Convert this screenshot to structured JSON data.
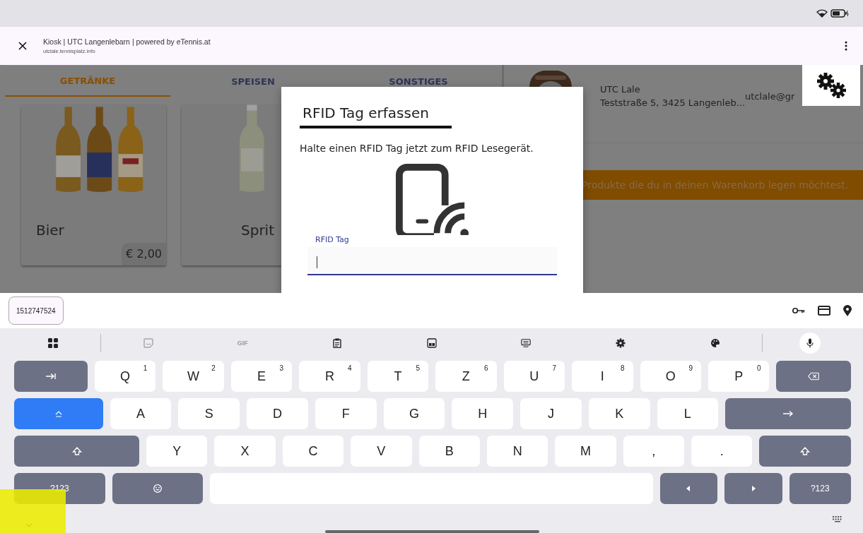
{
  "browser": {
    "title": "Kiosk | UTC Langenlebarn | powered by eTennis.at",
    "url": "utclale.tennisplatz.info"
  },
  "tabs": [
    {
      "label": "GETRÄNKE",
      "selected": true
    },
    {
      "label": "SPEISEN",
      "selected": false
    },
    {
      "label": "SONSTIGES",
      "selected": false
    }
  ],
  "products": [
    {
      "name": "Bier",
      "price": "€ 2,00"
    },
    {
      "name": "Sprit"
    }
  ],
  "club": {
    "name": "UTC Lale",
    "address": "Teststraße 5, 3425 Langenleb...",
    "email": "utclale@gr"
  },
  "banner": "Produkte die du in deinen Warenkorb legen möchtest.",
  "dialog": {
    "title": "RFID Tag erfassen",
    "text": "Halte einen RFID Tag jetzt zum RFID Lesegerät.",
    "field_label": "RFID Tag"
  },
  "suggestion": "1512747524",
  "toolbar": [
    {
      "kind": "apps",
      "disabled": false
    },
    {
      "kind": "sticker",
      "disabled": true
    },
    {
      "kind": "gif",
      "label": "GIF",
      "disabled": true
    },
    {
      "kind": "clipboard",
      "disabled": false
    },
    {
      "kind": "translate",
      "disabled": false
    },
    {
      "kind": "screen",
      "disabled": false
    },
    {
      "kind": "settings",
      "disabled": false
    },
    {
      "kind": "palette",
      "disabled": false
    },
    {
      "kind": "mic",
      "disabled": false
    }
  ],
  "rows": [
    [
      {
        "kind": "tab"
      },
      {
        "kind": "letter",
        "label": "Q",
        "hint": "1"
      },
      {
        "kind": "letter",
        "label": "W",
        "hint": "2"
      },
      {
        "kind": "letter",
        "label": "E",
        "hint": "3"
      },
      {
        "kind": "letter",
        "label": "R",
        "hint": "4"
      },
      {
        "kind": "letter",
        "label": "T",
        "hint": "5"
      },
      {
        "kind": "letter",
        "label": "Z",
        "hint": "6"
      },
      {
        "kind": "letter",
        "label": "U",
        "hint": "7"
      },
      {
        "kind": "letter",
        "label": "I",
        "hint": "8"
      },
      {
        "kind": "letter",
        "label": "O",
        "hint": "9"
      },
      {
        "kind": "letter",
        "label": "P",
        "hint": "0"
      },
      {
        "kind": "backspace"
      }
    ],
    [
      {
        "kind": "caps",
        "on": true
      },
      {
        "kind": "letter",
        "label": "A"
      },
      {
        "kind": "letter",
        "label": "S"
      },
      {
        "kind": "letter",
        "label": "D"
      },
      {
        "kind": "letter",
        "label": "F"
      },
      {
        "kind": "letter",
        "label": "G"
      },
      {
        "kind": "letter",
        "label": "H"
      },
      {
        "kind": "letter",
        "label": "J"
      },
      {
        "kind": "letter",
        "label": "K"
      },
      {
        "kind": "letter",
        "label": "L"
      },
      {
        "kind": "enter"
      }
    ],
    [
      {
        "kind": "shift"
      },
      {
        "kind": "letter",
        "label": "Y"
      },
      {
        "kind": "letter",
        "label": "X"
      },
      {
        "kind": "letter",
        "label": "C"
      },
      {
        "kind": "letter",
        "label": "V"
      },
      {
        "kind": "letter",
        "label": "B"
      },
      {
        "kind": "letter",
        "label": "N"
      },
      {
        "kind": "letter",
        "label": "M"
      },
      {
        "kind": "letter",
        "label": ","
      },
      {
        "kind": "letter",
        "label": "."
      },
      {
        "kind": "shift2"
      }
    ],
    [
      {
        "kind": "symbols",
        "label": "?123"
      },
      {
        "kind": "emoji"
      },
      {
        "kind": "space"
      },
      {
        "kind": "left"
      },
      {
        "kind": "right"
      },
      {
        "kind": "symbols2",
        "label": "?123"
      }
    ]
  ],
  "touch_highlight": true
}
